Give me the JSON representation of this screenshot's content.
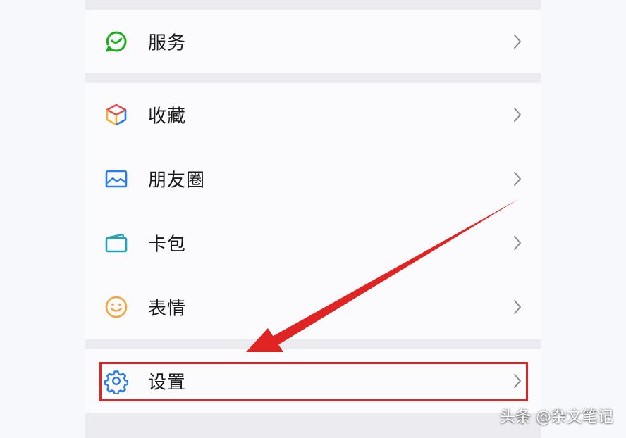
{
  "menu": {
    "items": [
      {
        "label": "服务",
        "icon": "service-icon"
      },
      {
        "label": "收藏",
        "icon": "favorites-cube-icon"
      },
      {
        "label": "朋友圈",
        "icon": "moments-picture-icon"
      },
      {
        "label": "卡包",
        "icon": "card-wallet-icon"
      },
      {
        "label": "表情",
        "icon": "sticker-smile-icon"
      },
      {
        "label": "设置",
        "icon": "gear-icon"
      }
    ]
  },
  "annotation": {
    "color": "#e02424",
    "target": "设置"
  },
  "watermark": {
    "text": "头条 @杂文笔记"
  },
  "colors": {
    "service_green": "#1aad19",
    "icon_blue": "#2b7de9",
    "smile_orange": "#f3a53b",
    "accent_red": "#e02424"
  }
}
